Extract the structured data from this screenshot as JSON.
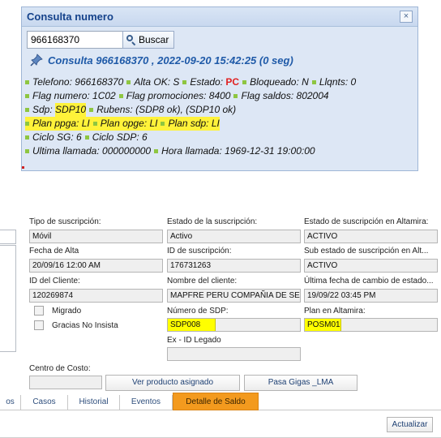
{
  "popup": {
    "title": "Consulta numero",
    "close_label": "×",
    "search": {
      "value": "966168370",
      "button_label": "Buscar"
    },
    "consulta_header": "Consulta 966168370 , 2022-09-20 15:42:25 (0 seg)",
    "info": {
      "l1": {
        "a": "Telefono: 966168370",
        "b": "Alta OK: S",
        "c": "Estado:",
        "c_value": "PC",
        "d": "Bloqueado: N",
        "e": "Llqnts: 0"
      },
      "l2": {
        "a": "Flag numero: 1C02",
        "b": "Flag promociones: 8400",
        "c": "Flag saldos: 802004"
      },
      "l3": {
        "a_label": "Sdp:",
        "a_value": "SDP10",
        "b": "Rubens: (SDP8 ok), (SDP10 ok)"
      },
      "l4": {
        "a": "Plan ppga: LI",
        "b": "Plan opge: LI",
        "c": "Plan sdp: LI"
      },
      "l5": {
        "a": "Ciclo SG: 6",
        "b": "Ciclo SDP: 6"
      },
      "l6": {
        "a": "Ultima llamada: 000000000",
        "b": "Hora llamada: 1969-12-31 19:00:00"
      }
    }
  },
  "form": {
    "labels": {
      "tipo": "Tipo de suscripción:",
      "estado": "Estado de la suscripción:",
      "estado_altamira": "Estado de suscripción en Altamira:",
      "fecha_alta": "Fecha de Alta",
      "id_suscripcion": "ID de suscripción:",
      "sub_estado": "Sub estado de suscripción en Alt...",
      "id_cliente": "ID del Cliente:",
      "nombre_cliente": "Nombre del cliente:",
      "ultima_fecha": "Última fecha de cambio de estado...",
      "migrado": "Migrado",
      "gracias": "Gracias No Insista",
      "numero_sdp": "Número de SDP:",
      "plan_altamira": "Plan en Altamira:",
      "ex_id": "Ex - ID Legado",
      "centro_costo": "Centro de Costo:"
    },
    "values": {
      "tipo": "Móvil",
      "estado": "Activo",
      "estado_altamira": "ACTIVO",
      "fecha_alta": "20/09/16 12:00 AM",
      "id_suscripcion": "176731263",
      "sub_estado": "ACTIVO",
      "id_cliente": "120269874",
      "nombre_cliente": "MAPFRE PERU COMPAÑIA DE SEG",
      "ultima_fecha": "19/09/22 03:45 PM",
      "numero_sdp": "SDP008",
      "plan_altamira": "POSM01",
      "ex_id": "",
      "centro_costo": ""
    },
    "buttons": {
      "ver_producto": "Ver producto asignado",
      "pasa_gigas": "Pasa Gigas _LMA",
      "actualizar": "Actualizar"
    },
    "tabs": [
      "os",
      "Casos",
      "Historial",
      "Eventos",
      "Detalle de Saldo"
    ],
    "active_tab": "Detalle de Saldo"
  },
  "colors": {
    "highlight": "#fff23a",
    "sdp_field_yellow": "#ffff00",
    "active_tab": "#f39a1e",
    "estado_pc": "#e02020",
    "bullet_green": "#8ec641",
    "consulta_blue": "#1f5aa8"
  },
  "icons": {
    "pin": "pushpin-icon",
    "search": "magnifier-icon",
    "close": "close-icon"
  }
}
